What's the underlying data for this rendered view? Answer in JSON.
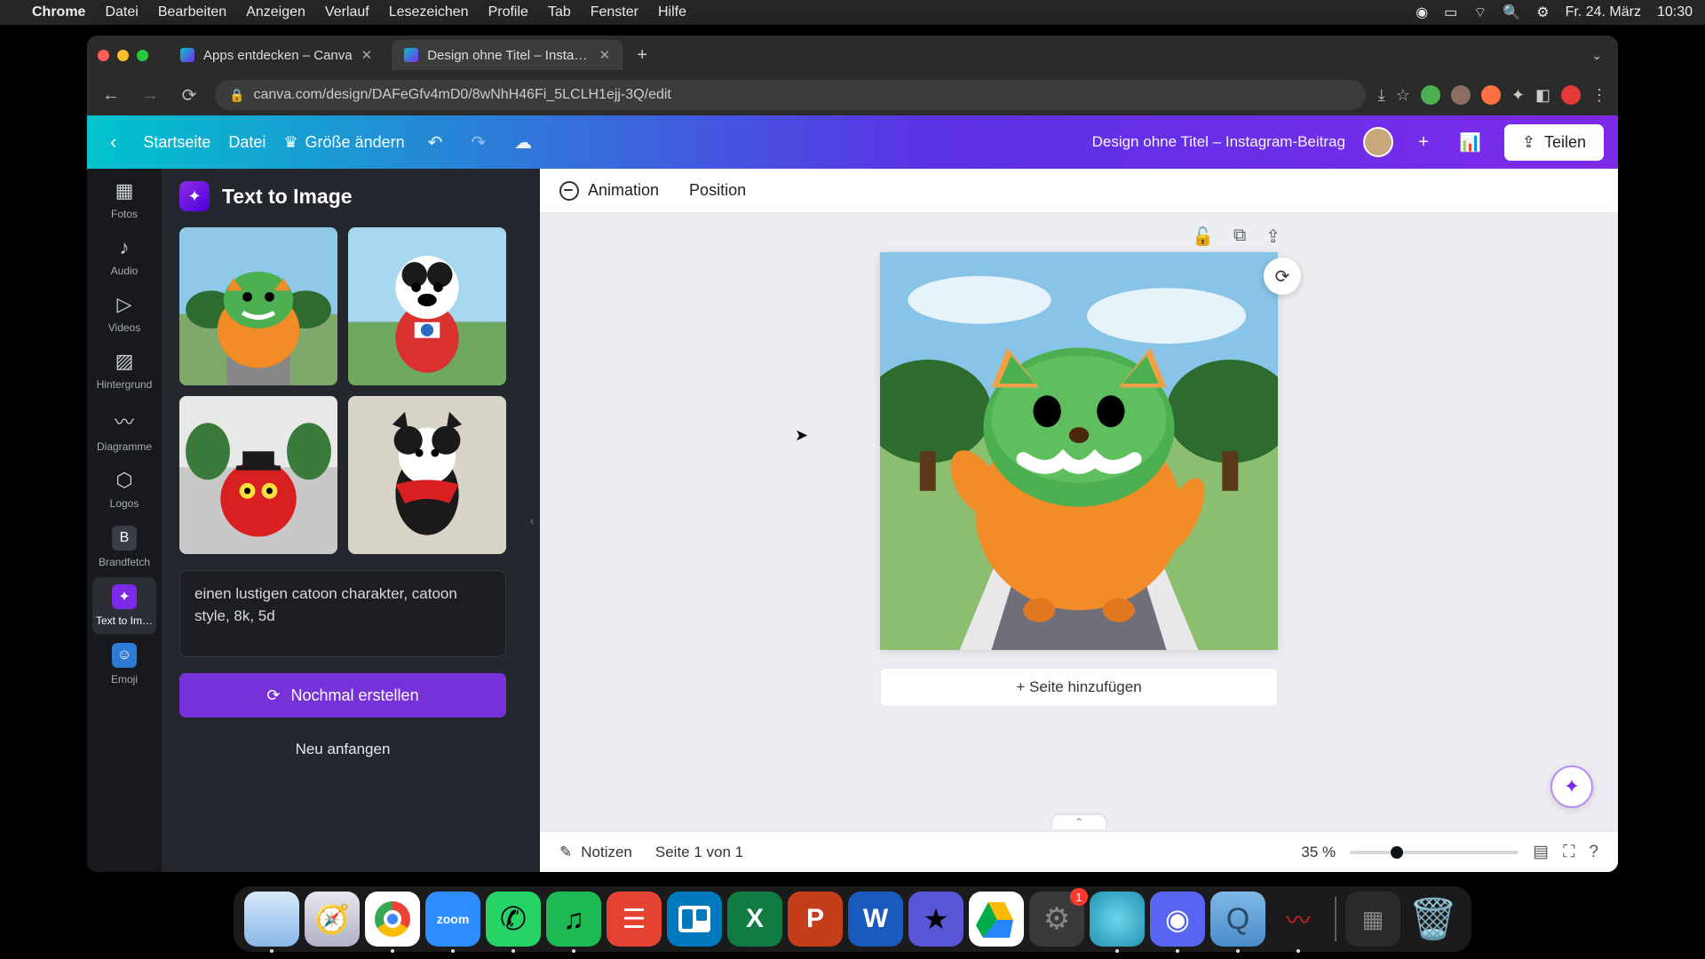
{
  "menubar": {
    "app": "Chrome",
    "items": [
      "Datei",
      "Bearbeiten",
      "Anzeigen",
      "Verlauf",
      "Lesezeichen",
      "Profile",
      "Tab",
      "Fenster",
      "Hilfe"
    ],
    "date": "Fr. 24. März",
    "time": "10:30"
  },
  "tabs": [
    {
      "label": "Apps entdecken – Canva",
      "active": false
    },
    {
      "label": "Design ohne Titel – Instagram-…",
      "active": true
    }
  ],
  "url": "canva.com/design/DAFeGfv4mD0/8wNhH46Fi_5LCLH1ejj-3Q/edit",
  "canva": {
    "home": "Startseite",
    "file": "Datei",
    "resize": "Größe ändern",
    "title": "Design ohne Titel – Instagram-Beitrag",
    "share": "Teilen"
  },
  "rail": [
    {
      "label": "Fotos"
    },
    {
      "label": "Audio"
    },
    {
      "label": "Videos"
    },
    {
      "label": "Hintergrund"
    },
    {
      "label": "Diagramme"
    },
    {
      "label": "Logos"
    },
    {
      "label": "Brandfetch"
    },
    {
      "label": "Text to Im…"
    },
    {
      "label": "Emoji"
    }
  ],
  "panel": {
    "title": "Text to Image",
    "prompt": "einen lustigen catoon charakter, catoon style, 8k, 5d",
    "regen": "Nochmal erstellen",
    "restart": "Neu anfangen"
  },
  "ctx": {
    "animation": "Animation",
    "position": "Position"
  },
  "stage": {
    "add_page": "+ Seite hinzufügen"
  },
  "footer": {
    "notes": "Notizen",
    "page": "Seite 1 von 1",
    "zoom": "35 %"
  },
  "dock_badge": "1"
}
